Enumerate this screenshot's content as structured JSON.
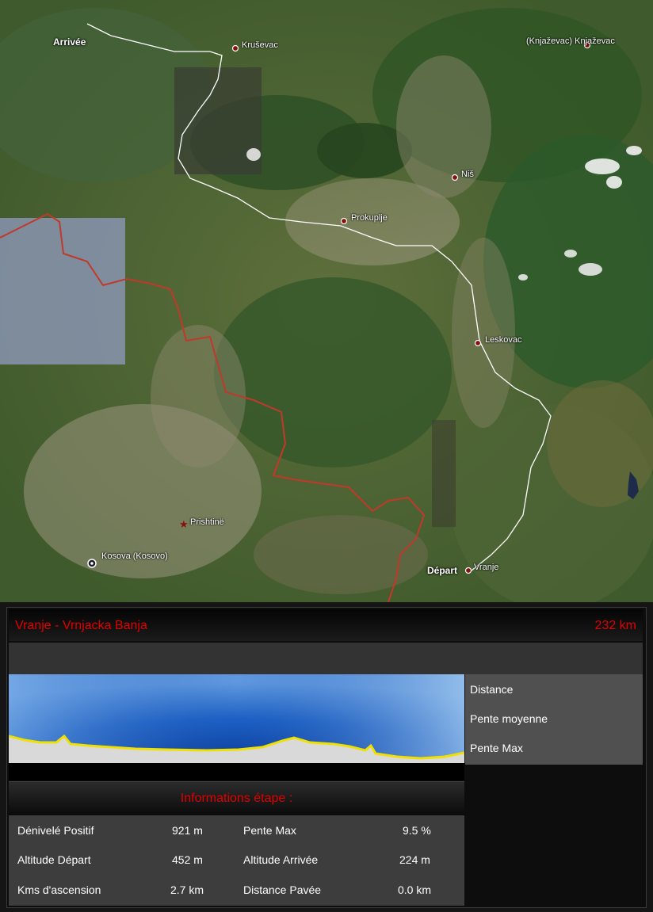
{
  "map": {
    "cities": [
      {
        "name": "Kruševac"
      },
      {
        "name": "(Knjaževac) Knjaževac"
      },
      {
        "name": "Niš"
      },
      {
        "name": "Prokuplje"
      },
      {
        "name": "Leskovac"
      },
      {
        "name": "Prishtinë"
      },
      {
        "name": "Kosova (Kosovo)"
      },
      {
        "name": "Vranje"
      }
    ],
    "arrival_label": "Arrivée",
    "departure_label": "Départ",
    "route_color": "#ffffff",
    "border_color": "#c0392b"
  },
  "stage": {
    "title": "Vranje - Vrnjacka Banja",
    "distance": "232 km",
    "accent_color": "#e00000"
  },
  "side": {
    "items": [
      "Distance",
      "Pente moyenne",
      "Pente Max"
    ]
  },
  "info": {
    "title": "Informations étape :",
    "rows": [
      {
        "label1": "Dénivelé Positif",
        "value1": "921 m",
        "label2": "Pente Max",
        "value2": "9.5 %"
      },
      {
        "label1": "Altitude Départ",
        "value1": "452 m",
        "label2": "Altitude Arrivée",
        "value2": "224 m"
      },
      {
        "label1": "Kms d'ascension",
        "value1": "2.7 km",
        "label2": "Distance Pavée",
        "value2": "0.0 km"
      }
    ]
  }
}
